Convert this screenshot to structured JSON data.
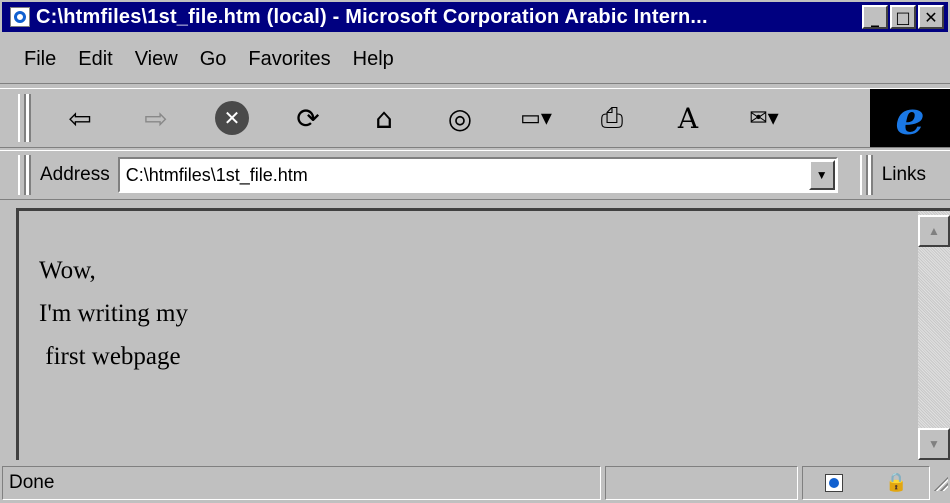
{
  "window": {
    "title": "C:\\htmfiles\\1st_file.htm (local) - Microsoft Corporation Arabic Intern...",
    "minimize_label": "_",
    "maximize_label": "□",
    "close_label": "✕"
  },
  "menu": {
    "items": [
      "File",
      "Edit",
      "View",
      "Go",
      "Favorites",
      "Help"
    ]
  },
  "toolbar": {
    "buttons": [
      {
        "name": "back",
        "icon": "back-arrow-icon",
        "glyph": "⇦"
      },
      {
        "name": "forward",
        "icon": "forward-arrow-icon",
        "glyph": "⇨"
      },
      {
        "name": "stop",
        "icon": "stop-icon",
        "glyph": "✕"
      },
      {
        "name": "refresh",
        "icon": "refresh-icon",
        "glyph": "⟳"
      },
      {
        "name": "home",
        "icon": "home-icon",
        "glyph": "⌂"
      },
      {
        "name": "search",
        "icon": "search-icon",
        "glyph": "◎"
      },
      {
        "name": "favorites",
        "icon": "favorites-folder-icon",
        "glyph": "▭▾"
      },
      {
        "name": "print",
        "icon": "print-icon",
        "glyph": "⎙"
      },
      {
        "name": "font",
        "icon": "font-size-icon",
        "glyph": "A"
      },
      {
        "name": "mail",
        "icon": "mail-icon",
        "glyph": "✉▾"
      }
    ],
    "logo_glyph": "e"
  },
  "address": {
    "label": "Address",
    "value": "C:\\htmfiles\\1st_file.htm",
    "dropdown_glyph": "▼",
    "links_label": "Links"
  },
  "content": {
    "lines": [
      "Wow,",
      "I'm writing my",
      " first webpage"
    ]
  },
  "scrollbar": {
    "up_glyph": "▲",
    "down_glyph": "▼"
  },
  "status": {
    "text": "Done",
    "cert_glyph": "🔒"
  },
  "colors": {
    "titlebar": "#000080",
    "chrome": "#c0c0c0",
    "page_background": "#c0c0c0"
  }
}
